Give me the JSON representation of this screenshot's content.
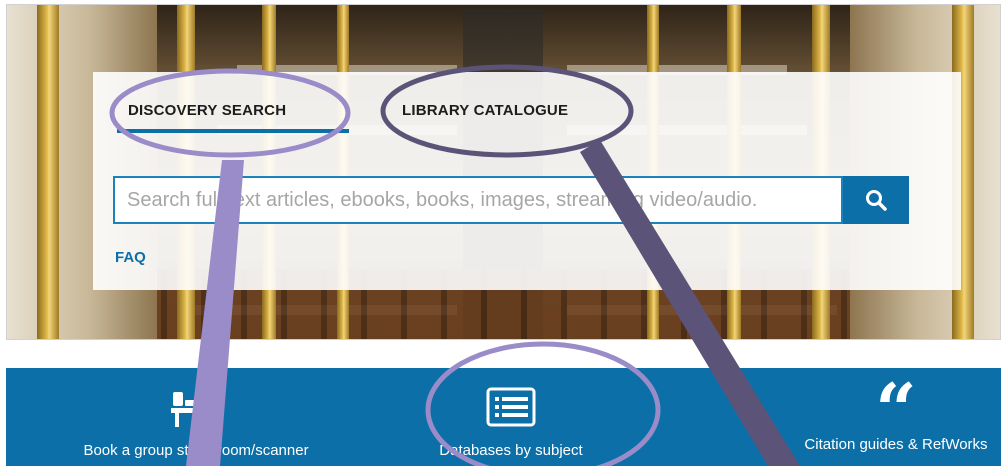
{
  "tabs": [
    {
      "label": "DISCOVERY SEARCH",
      "active": true
    },
    {
      "label": "LIBRARY CATALOGUE",
      "active": false
    }
  ],
  "search": {
    "placeholder": "Search full-text articles, ebooks, books, images, streaming video/audio.",
    "button_icon": "search-icon"
  },
  "faq_label": "FAQ",
  "quicklinks": [
    {
      "label": "Book a group study room/scanner",
      "icon": "group-study-room-icon"
    },
    {
      "label": "Databases by subject",
      "icon": "database-list-icon"
    },
    {
      "label": "Citation guides & RefWorks",
      "icon": "quote-icon"
    }
  ],
  "colors": {
    "brand_blue": "#0d6fa8",
    "annotation_light_purple": "#9a8cc8",
    "annotation_dark_purple": "#5c5478",
    "quicklinks_text": "#ffffff"
  }
}
